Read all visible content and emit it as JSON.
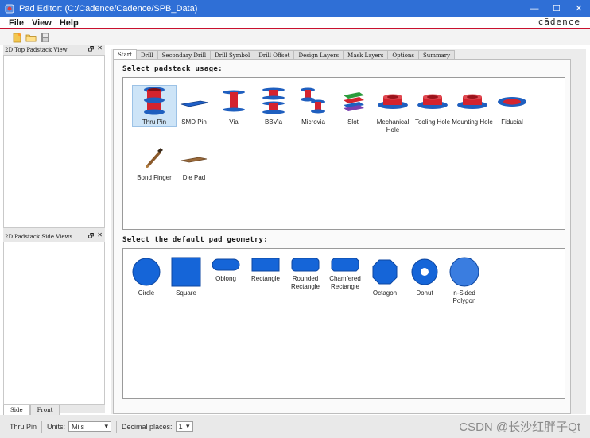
{
  "window": {
    "title": "Pad Editor:  (C:/Cadence/Cadence/SPB_Data)",
    "controls": {
      "minimize": "—",
      "maximize": "☐",
      "close": "✕"
    }
  },
  "menu": {
    "items": [
      "File",
      "View",
      "Help"
    ]
  },
  "brand": "cādence",
  "toolbar": {
    "icons": [
      "new-icon",
      "open-folder-icon",
      "save-icon"
    ]
  },
  "left_panels": {
    "top_view_title": "2D Top Padstack View",
    "side_view_title": "2D Padstack Side Views",
    "dock_controls": {
      "float": "🗗",
      "close": "✕"
    },
    "tabs": [
      "Side",
      "Front"
    ]
  },
  "main": {
    "tabs": [
      "Start",
      "Drill",
      "Secondary Drill",
      "Drill Symbol",
      "Drill Offset",
      "Design Layers",
      "Mask Layers",
      "Options",
      "Summary"
    ],
    "active_tab": "Start",
    "usage_title": "Select padstack usage:",
    "usage_items": [
      {
        "label": "Thru Pin",
        "selected": true
      },
      {
        "label": "SMD Pin"
      },
      {
        "label": "Via"
      },
      {
        "label": "BBVia"
      },
      {
        "label": "Microvia"
      },
      {
        "label": "Slot"
      },
      {
        "label": "Mechanical Hole"
      },
      {
        "label": "Tooling Hole"
      },
      {
        "label": "Mounting Hole"
      },
      {
        "label": "Fiducial"
      },
      {
        "label": "Bond Finger"
      },
      {
        "label": "Die Pad"
      }
    ],
    "geometry_title": "Select the default pad geometry:",
    "geometry_items": [
      {
        "label": "Circle"
      },
      {
        "label": "Square"
      },
      {
        "label": "Oblong"
      },
      {
        "label": "Rectangle"
      },
      {
        "label": "Rounded Rectangle"
      },
      {
        "label": "Chamfered Rectangle"
      },
      {
        "label": "Octagon"
      },
      {
        "label": "Donut"
      },
      {
        "label": "n-Sided Polygon"
      }
    ]
  },
  "status": {
    "usage": "Thru Pin",
    "units_label": "Units:",
    "units_value": "Mils",
    "decimal_label": "Decimal places:",
    "decimal_value": "1"
  },
  "watermark": "CSDN @长沙红胖子Qt",
  "colors": {
    "accent": "#2f6fd6",
    "shape_blue": "#1565d8",
    "brand_red": "#c8102e"
  }
}
